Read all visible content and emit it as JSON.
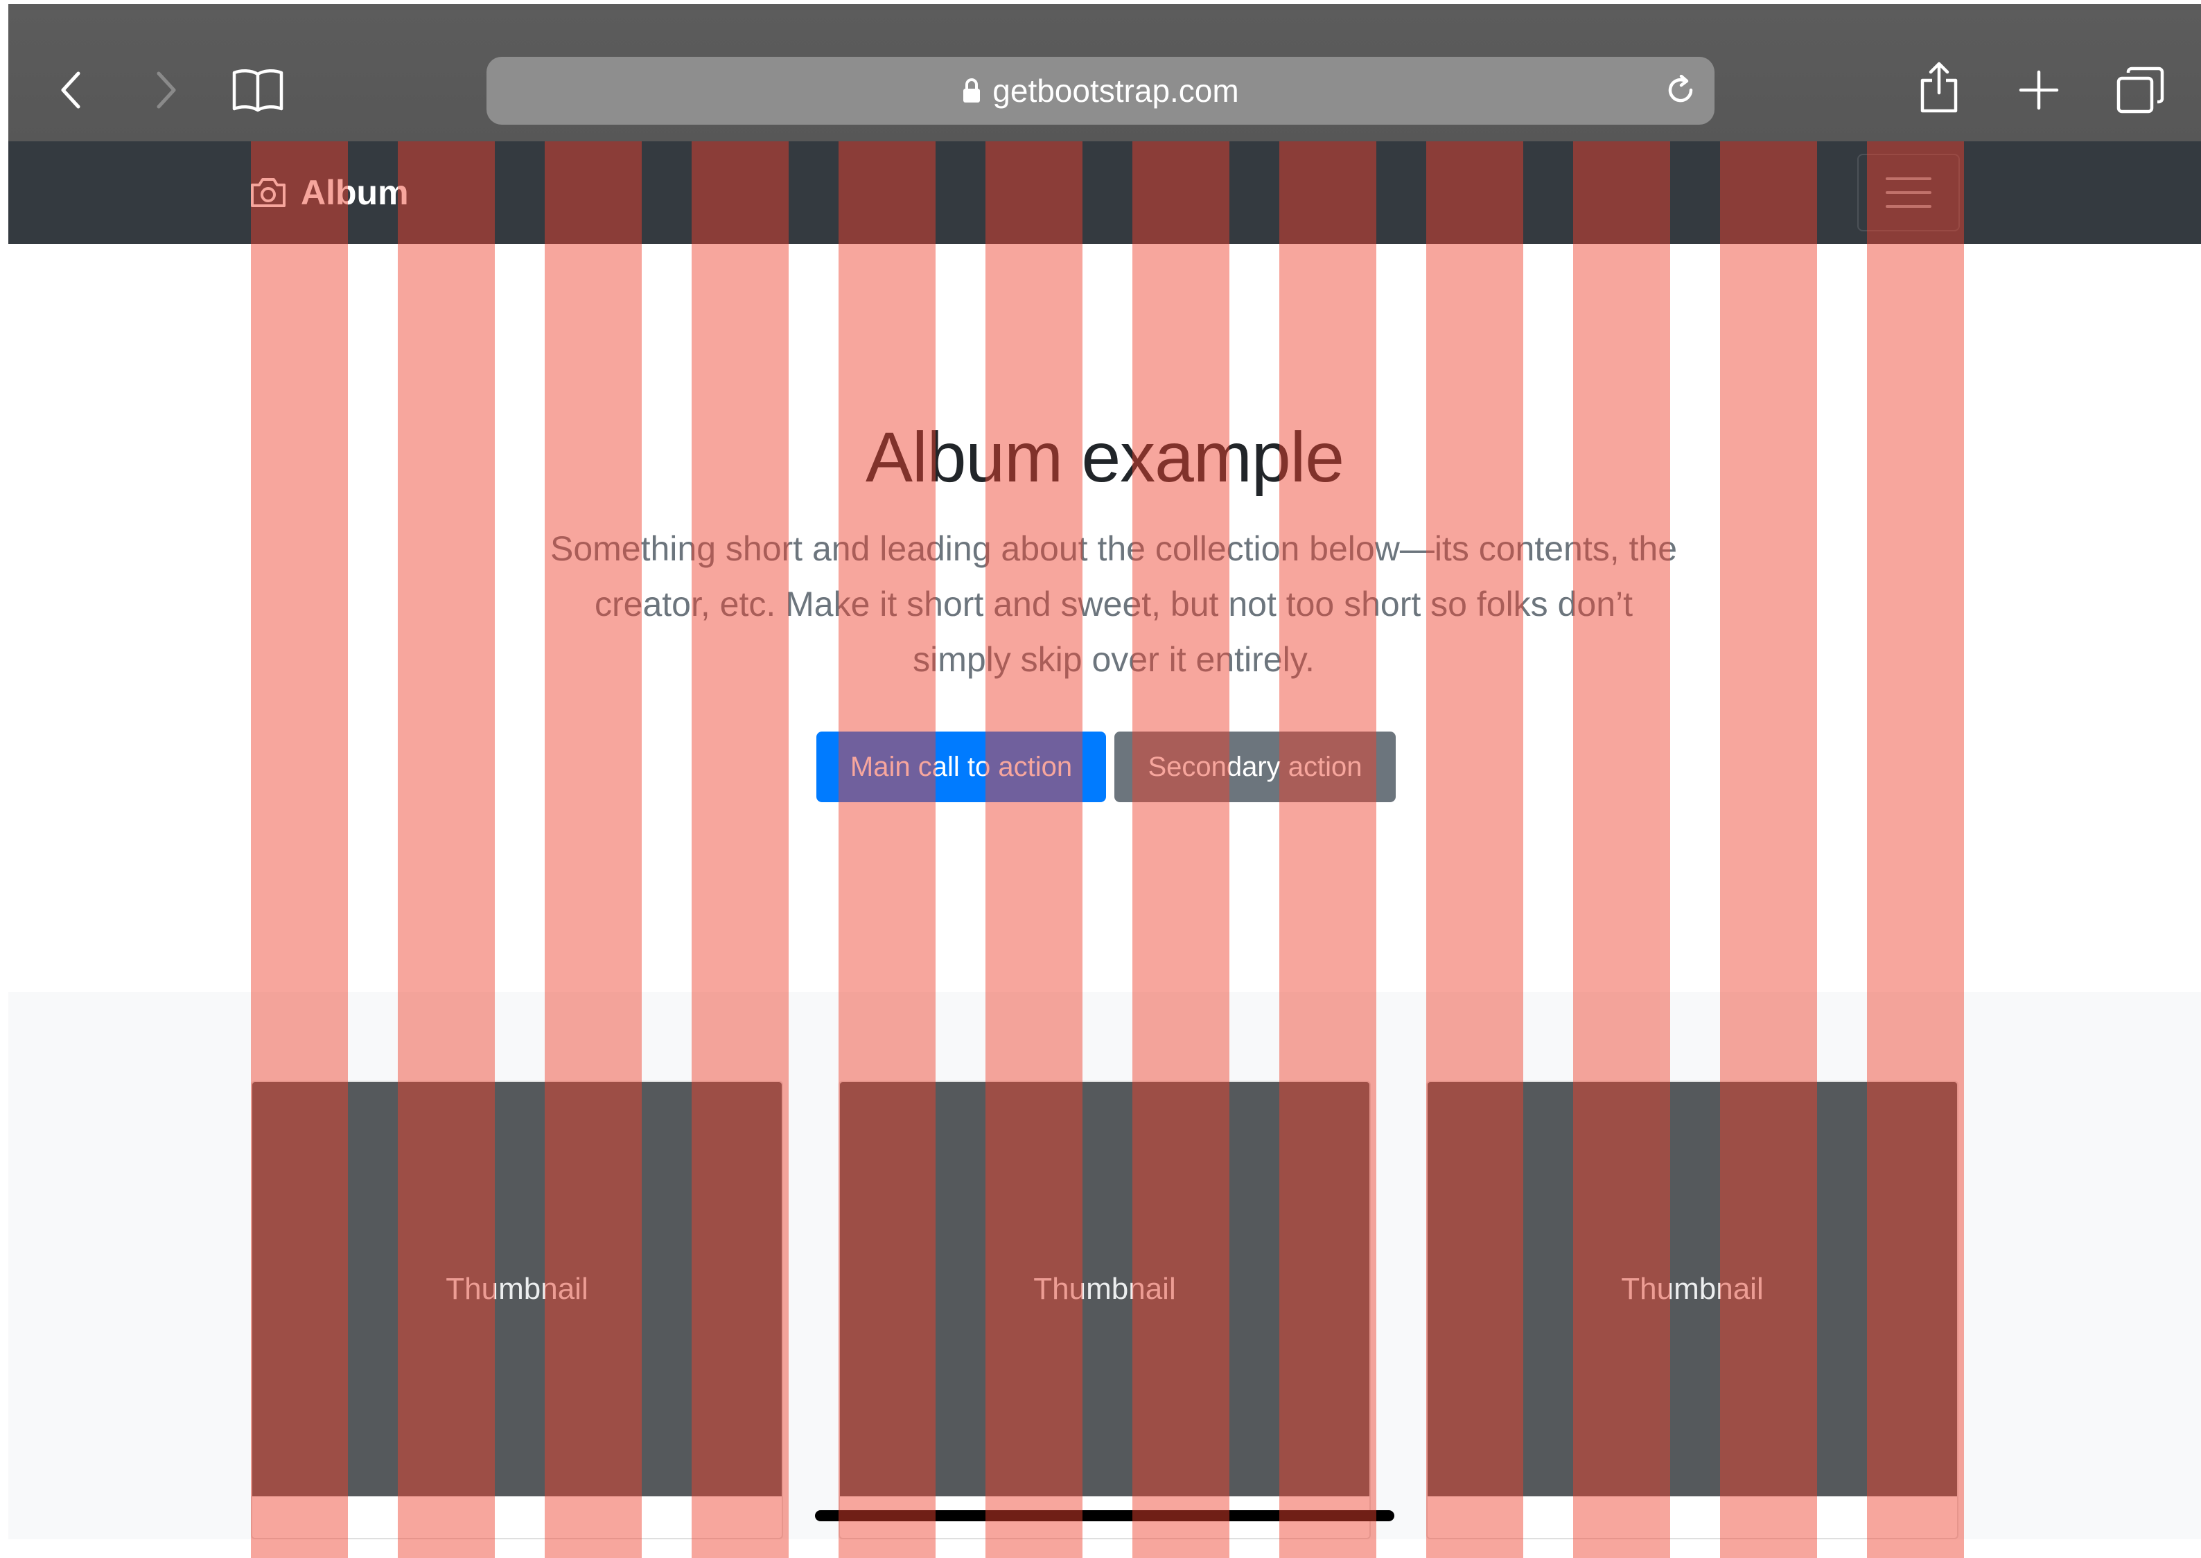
{
  "browser": {
    "url": "getbootstrap.com",
    "icons": {
      "back": "chevron-left-icon",
      "forward": "chevron-right-icon",
      "bookmarks": "book-icon",
      "lock": "lock-icon",
      "reload": "reload-icon",
      "share": "share-icon",
      "new_tab": "plus-icon",
      "tabs": "tabs-icon"
    }
  },
  "navbar": {
    "brand": "Album",
    "brand_icon": "camera-icon",
    "toggler_icon": "hamburger-icon"
  },
  "hero": {
    "title": "Album example",
    "lead": "Something short and leading about the collection below—its contents, the creator, etc. Make it short and sweet, but not too short so folks don’t simply skip over it entirely.",
    "primary_button": "Main call to action",
    "secondary_button": "Secondary action"
  },
  "album": {
    "cards": [
      {
        "thumbnail": "Thumbnail"
      },
      {
        "thumbnail": "Thumbnail"
      },
      {
        "thumbnail": "Thumbnail"
      }
    ]
  },
  "colors": {
    "navbar_bg": "#343a40",
    "primary": "#007bff",
    "secondary": "#6c757d",
    "thumbnail_bg": "#55595c",
    "grid_overlay": "#ef412e"
  }
}
